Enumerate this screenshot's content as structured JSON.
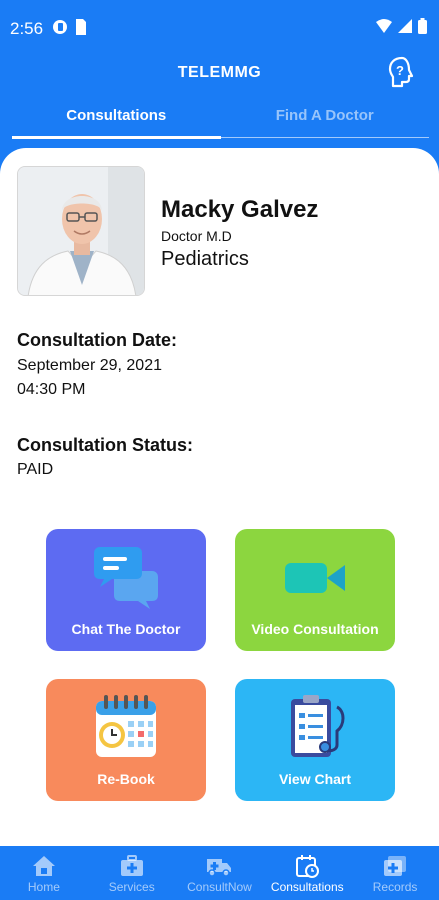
{
  "status_bar": {
    "time": "2:56"
  },
  "header": {
    "title": "TELEMMG"
  },
  "tabs": [
    {
      "label": "Consultations",
      "active": true
    },
    {
      "label": "Find A Doctor",
      "active": false
    }
  ],
  "doctor": {
    "name": "Macky Galvez",
    "title": "Doctor M.D",
    "specialty": "Pediatrics"
  },
  "consultation": {
    "date_label": "Consultation Date:",
    "date": "September 29, 2021",
    "time": "04:30 PM",
    "status_label": "Consultation Status:",
    "status": "PAID"
  },
  "actions": [
    {
      "label": "Chat The Doctor",
      "icon": "chat-bubbles-icon",
      "color": "#5d6bf2"
    },
    {
      "label": "Video Consultation",
      "icon": "video-camera-icon",
      "color": "#8cd63f"
    },
    {
      "label": "Re-Book",
      "icon": "calendar-clock-icon",
      "color": "#f88a5c"
    },
    {
      "label": "View Chart",
      "icon": "clipboard-stethoscope-icon",
      "color": "#2cb6f5"
    }
  ],
  "bottom_nav": [
    {
      "label": "Home",
      "icon": "home-icon",
      "active": false
    },
    {
      "label": "Services",
      "icon": "medical-kit-icon",
      "active": false
    },
    {
      "label": "ConsultNow",
      "icon": "ambulance-icon",
      "active": false
    },
    {
      "label": "Consultations",
      "icon": "calendar-clock-icon",
      "active": true
    },
    {
      "label": "Records",
      "icon": "records-folder-icon",
      "active": false
    }
  ],
  "colors": {
    "primary": "#1a7cf5",
    "background_card": "#ffffff"
  }
}
